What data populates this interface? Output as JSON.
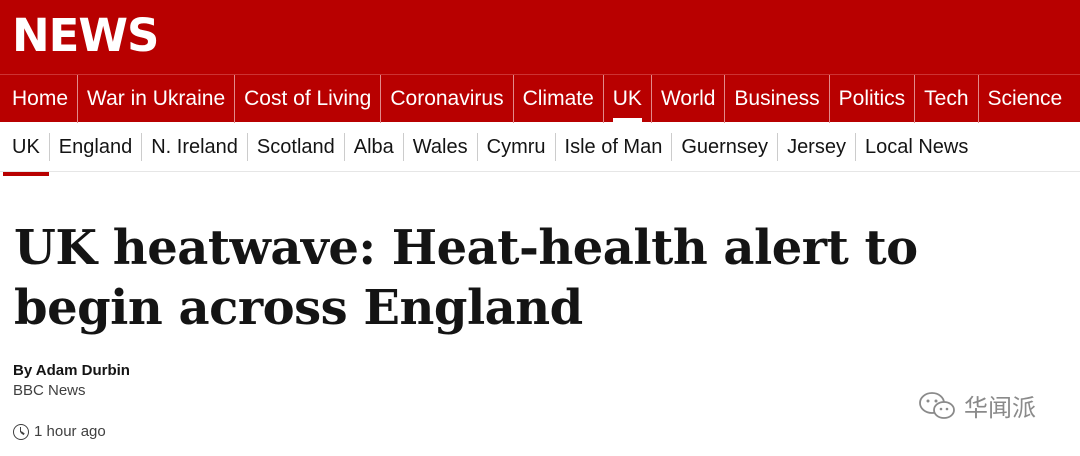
{
  "masthead": {
    "logo_text": "NEWS",
    "brand_color": "#b80000"
  },
  "primary_nav": {
    "items": [
      {
        "label": "Home"
      },
      {
        "label": "War in Ukraine"
      },
      {
        "label": "Cost of Living"
      },
      {
        "label": "Coronavirus"
      },
      {
        "label": "Climate"
      },
      {
        "label": "UK",
        "active": true
      },
      {
        "label": "World"
      },
      {
        "label": "Business"
      },
      {
        "label": "Politics"
      },
      {
        "label": "Tech"
      },
      {
        "label": "Science"
      }
    ]
  },
  "secondary_nav": {
    "items": [
      {
        "label": "UK",
        "active": true
      },
      {
        "label": "England"
      },
      {
        "label": "N. Ireland"
      },
      {
        "label": "Scotland"
      },
      {
        "label": "Alba"
      },
      {
        "label": "Wales"
      },
      {
        "label": "Cymru"
      },
      {
        "label": "Isle of Man"
      },
      {
        "label": "Guernsey"
      },
      {
        "label": "Jersey"
      },
      {
        "label": "Local News"
      }
    ]
  },
  "article": {
    "headline_line1": "UK heatwave: Heat-health alert to",
    "headline_line2": "begin across England",
    "byline_name": "By Adam Durbin",
    "byline_org": "BBC News",
    "timestamp": "1 hour ago"
  },
  "watermark": {
    "text": "华闻派",
    "icon": "wechat-icon"
  }
}
